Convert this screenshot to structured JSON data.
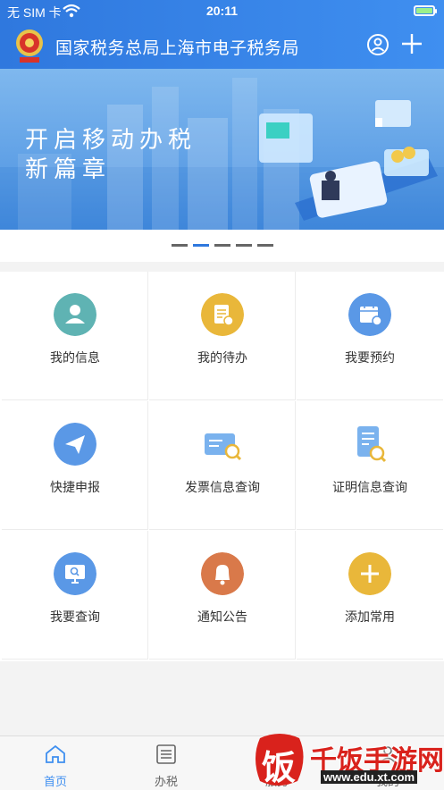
{
  "status_bar": {
    "carrier": "无 SIM 卡",
    "time": "20:11"
  },
  "header": {
    "title": "国家税务总局上海市电子税务局"
  },
  "banner": {
    "line1": "开启移动办税",
    "line2": "新篇章"
  },
  "carousel": {
    "count": 5,
    "active": 2
  },
  "grid": [
    {
      "label": "我的信息",
      "icon": "user-icon",
      "color": "#5fb3b3"
    },
    {
      "label": "我的待办",
      "icon": "todo-icon",
      "color": "#e9b73a"
    },
    {
      "label": "我要预约",
      "icon": "calendar-icon",
      "color": "#5a98e6"
    },
    {
      "label": "快捷申报",
      "icon": "paper-plane-icon",
      "color": "#5a98e6"
    },
    {
      "label": "发票信息查询",
      "icon": "invoice-search-icon",
      "color": "#5a98e6"
    },
    {
      "label": "证明信息查询",
      "icon": "certificate-search-icon",
      "color": "#5a98e6"
    },
    {
      "label": "我要查询",
      "icon": "monitor-search-icon",
      "color": "#5a98e6"
    },
    {
      "label": "通知公告",
      "icon": "bell-icon",
      "color": "#d9794a"
    },
    {
      "label": "添加常用",
      "icon": "add-icon",
      "color": "#e9b73a"
    }
  ],
  "tabs": [
    {
      "label": "首页",
      "active": true,
      "color": "#3f8ff0"
    },
    {
      "label": "办税",
      "active": false
    },
    {
      "label": "服务",
      "active": false
    },
    {
      "label": "我的",
      "active": false
    }
  ],
  "watermark": {
    "text": "千饭手游网",
    "glyph": "饭",
    "url": "www.edu.xt.com"
  }
}
